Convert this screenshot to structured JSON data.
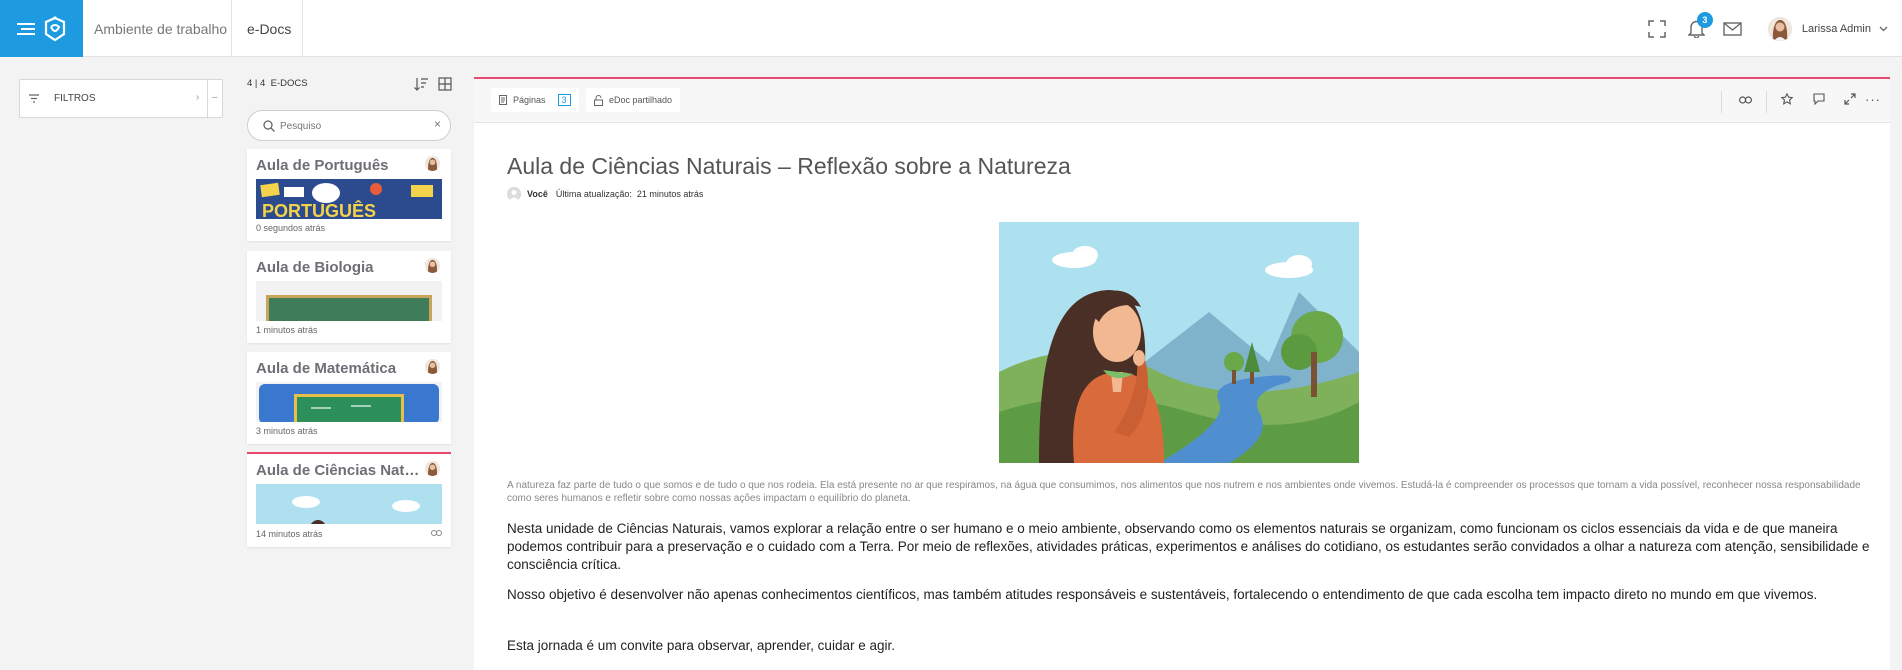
{
  "header": {
    "breadcrumb_workspace": "Ambiente de trabalho",
    "breadcrumb_section": "e-Docs",
    "notification_count": "3",
    "user_name": "Larissa Admin",
    "accent_color": "#1e9be0"
  },
  "filters": {
    "label": "FILTROS"
  },
  "list": {
    "count": "4 | 4",
    "count_label": "E-DOCS",
    "search_placeholder": "Pesquiso",
    "items": [
      {
        "title": "Aula de Português",
        "time": "0 segundos atrás"
      },
      {
        "title": "Aula de Biologia",
        "time": "1 minutos atrás"
      },
      {
        "title": "Aula de Matemática",
        "time": "3 minutos atrás"
      },
      {
        "title": "Aula de Ciências Naturais – Reflexão sobre a Natureza",
        "time": "14 minutos atrás"
      }
    ]
  },
  "doc": {
    "pages_label": "Páginas",
    "pages_count": "3",
    "shared_label": "eDoc partilhado",
    "title": "Aula de Ciências Naturais – Reflexão sobre a Natureza",
    "author": "Você",
    "updated_label": "Última atualização:",
    "updated_value": "21 minutos atrás",
    "intro": "A natureza faz parte de tudo o que somos e de tudo o que nos rodeia. Ela está presente no ar que respiramos, na água que consumimos, nos alimentos que nos nutrem e nos ambientes onde vivemos. Estudá-la é compreender os processos que tornam a vida possível, reconhecer nossa responsabilidade como seres humanos e refletir sobre como nossas ações impactam o equilíbrio do planeta.",
    "paragraph1": "Nesta unidade de Ciências Naturais, vamos explorar a relação entre o ser humano e o meio ambiente, observando como os elementos naturais se organizam, como funcionam os ciclos essenciais da vida e de que maneira podemos contribuir para a preservação e o cuidado com a Terra. Por meio de reflexões, atividades práticas, experimentos e análises do cotidiano, os estudantes serão convidados a olhar a natureza com atenção, sensibilidade e consciência crítica.",
    "paragraph2": "Nosso objetivo é desenvolver não apenas conhecimentos científicos, mas também atitudes responsáveis e sustentáveis, fortalecendo o entendimento de que cada escolha tem impacto direto no mundo em que vivemos.",
    "paragraph3": "Esta jornada é um convite para observar, aprender, cuidar e agir."
  }
}
